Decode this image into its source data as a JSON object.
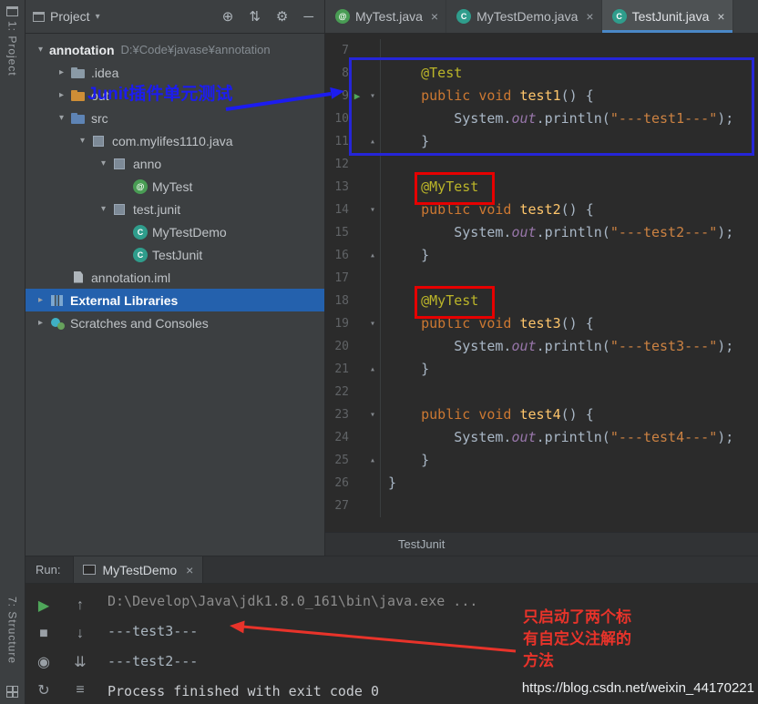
{
  "stripe": {
    "top_label": "1: Project",
    "bottom_label": "7: Structure"
  },
  "header": {
    "project_selector": "Project",
    "chevron": "▾",
    "icons": [
      {
        "name": "locate-file-icon",
        "glyph": "⊕"
      },
      {
        "name": "filter-icon",
        "glyph": "⇅"
      },
      {
        "name": "settings-gear-icon",
        "glyph": "⚙"
      },
      {
        "name": "hide-panel-icon",
        "glyph": "─"
      }
    ]
  },
  "file_icons": {
    "annotation": "@",
    "class": "C"
  },
  "editor_tabs": [
    {
      "label": "MyTest.java",
      "icon": "annotation",
      "close": "×",
      "active": false
    },
    {
      "label": "MyTestDemo.java",
      "icon": "class",
      "close": "×",
      "active": false
    },
    {
      "label": "TestJunit.java",
      "icon": "class",
      "close": "×",
      "active": true
    }
  ],
  "project_tree": [
    {
      "depth": 0,
      "chevron": "▾",
      "icon": "",
      "label": "annotation",
      "path": "D:¥Code¥javase¥annotation",
      "bold": true
    },
    {
      "depth": 1,
      "chevron": "▸",
      "icon": "folder",
      "label": ".idea"
    },
    {
      "depth": 1,
      "chevron": "▸",
      "icon": "folder-out",
      "label": "out"
    },
    {
      "depth": 1,
      "chevron": "▾",
      "icon": "folder-src",
      "label": "src"
    },
    {
      "depth": 2,
      "chevron": "▾",
      "icon": "package",
      "label": "com.mylifes1110.java"
    },
    {
      "depth": 3,
      "chevron": "▾",
      "icon": "package",
      "label": "anno"
    },
    {
      "depth": 4,
      "chevron": "",
      "icon": "annotation",
      "label": "MyTest"
    },
    {
      "depth": 3,
      "chevron": "▾",
      "icon": "package",
      "label": "test.junit"
    },
    {
      "depth": 4,
      "chevron": "",
      "icon": "class",
      "label": "MyTestDemo"
    },
    {
      "depth": 4,
      "chevron": "",
      "icon": "class",
      "label": "TestJunit"
    },
    {
      "depth": 1,
      "chevron": "",
      "icon": "file",
      "label": "annotation.iml"
    },
    {
      "depth": 0,
      "chevron": "▸",
      "icon": "library",
      "label": "External Libraries",
      "selected": true
    },
    {
      "depth": 0,
      "chevron": "▸",
      "icon": "scratch",
      "label": "Scratches and Consoles"
    }
  ],
  "code": {
    "breadcrumb": "TestJunit",
    "icons": {
      "run": "▶",
      "fold_open": "▾",
      "fold_close": "▴"
    },
    "lines": [
      {
        "n": "7",
        "tok": []
      },
      {
        "n": "8",
        "tok": [
          [
            "ann",
            "    @Test"
          ]
        ]
      },
      {
        "n": "9",
        "run": true,
        "fold": "open",
        "tok": [
          [
            "kw",
            "    public void "
          ],
          [
            "fn",
            "test1"
          ],
          [
            "pl",
            "() {"
          ]
        ]
      },
      {
        "n": "10",
        "tok": [
          [
            "pl",
            "        System."
          ],
          [
            "fld",
            "out"
          ],
          [
            "pl",
            ".println("
          ],
          [
            "str",
            "\"---test1---\""
          ],
          [
            "pl",
            ");"
          ]
        ]
      },
      {
        "n": "11",
        "fold": "close",
        "tok": [
          [
            "pl",
            "    }"
          ]
        ]
      },
      {
        "n": "12",
        "tok": []
      },
      {
        "n": "13",
        "tok": [
          [
            "ann",
            "    @MyTest"
          ]
        ]
      },
      {
        "n": "14",
        "fold": "open",
        "tok": [
          [
            "kw",
            "    public void "
          ],
          [
            "fn",
            "test2"
          ],
          [
            "pl",
            "() {"
          ]
        ]
      },
      {
        "n": "15",
        "tok": [
          [
            "pl",
            "        System."
          ],
          [
            "fld",
            "out"
          ],
          [
            "pl",
            ".println("
          ],
          [
            "str",
            "\"---test2---\""
          ],
          [
            "pl",
            ");"
          ]
        ]
      },
      {
        "n": "16",
        "fold": "close",
        "tok": [
          [
            "pl",
            "    }"
          ]
        ]
      },
      {
        "n": "17",
        "tok": []
      },
      {
        "n": "18",
        "tok": [
          [
            "ann",
            "    @MyTest"
          ]
        ]
      },
      {
        "n": "19",
        "fold": "open",
        "tok": [
          [
            "kw",
            "    public void "
          ],
          [
            "fn",
            "test3"
          ],
          [
            "pl",
            "() {"
          ]
        ]
      },
      {
        "n": "20",
        "tok": [
          [
            "pl",
            "        System."
          ],
          [
            "fld",
            "out"
          ],
          [
            "pl",
            ".println("
          ],
          [
            "str",
            "\"---test3---\""
          ],
          [
            "pl",
            ");"
          ]
        ]
      },
      {
        "n": "21",
        "fold": "close",
        "tok": [
          [
            "pl",
            "    }"
          ]
        ]
      },
      {
        "n": "22",
        "tok": []
      },
      {
        "n": "23",
        "fold": "open",
        "tok": [
          [
            "kw",
            "    public void "
          ],
          [
            "fn",
            "test4"
          ],
          [
            "pl",
            "() {"
          ]
        ]
      },
      {
        "n": "24",
        "tok": [
          [
            "pl",
            "        System."
          ],
          [
            "fld",
            "out"
          ],
          [
            "pl",
            ".println("
          ],
          [
            "str",
            "\"---test4---\""
          ],
          [
            "pl",
            ");"
          ]
        ]
      },
      {
        "n": "25",
        "fold": "close",
        "tok": [
          [
            "pl",
            "    }"
          ]
        ]
      },
      {
        "n": "26",
        "tok": [
          [
            "pl",
            "}"
          ]
        ]
      },
      {
        "n": "27",
        "tok": []
      }
    ]
  },
  "run_panel": {
    "label": "Run:",
    "tab": {
      "label": "MyTestDemo",
      "close": "×"
    },
    "toolbar_col1": [
      {
        "name": "rerun-icon",
        "glyph": "▶",
        "cls": "green"
      },
      {
        "name": "stop-icon",
        "glyph": "■"
      },
      {
        "name": "dump-threads-icon",
        "glyph": "◉"
      },
      {
        "name": "restore-layout-icon",
        "glyph": "↻"
      }
    ],
    "toolbar_col2": [
      {
        "name": "up-stack-trace-icon",
        "glyph": "↑"
      },
      {
        "name": "down-stack-trace-icon",
        "glyph": "↓"
      },
      {
        "name": "scroll-to-end-icon",
        "glyph": "⇊"
      },
      {
        "name": "soft-wrap-icon",
        "glyph": "≡"
      }
    ],
    "console": [
      {
        "cls": "cmd",
        "text": "D:\\Develop\\Java\\jdk1.8.0_161\\bin\\java.exe ..."
      },
      {
        "cls": "out",
        "text": "---test3---"
      },
      {
        "cls": "out",
        "text": "---test2---"
      },
      {
        "cls": "proc",
        "text": "Process finished with exit code 0"
      }
    ]
  },
  "annotations": {
    "junit_note": "Junit插件单元测试",
    "result_note": "只启动了两个标\n有自定义注解的\n方法",
    "watermark": "https://blog.csdn.net/weixin_44170221",
    "blue": "#1c1cf0",
    "red": "#e8332a"
  }
}
